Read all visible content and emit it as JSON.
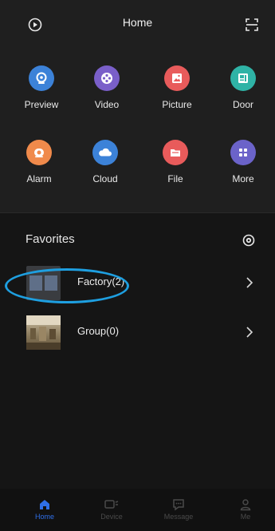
{
  "header": {
    "title": "Home",
    "left_icon": "playback-icon",
    "right_icon": "scan-icon"
  },
  "quick_actions": [
    {
      "label": "Preview",
      "icon": "camera-icon",
      "color": "#3c82d8"
    },
    {
      "label": "Video",
      "icon": "film-reel-icon",
      "color": "#7a5fc9"
    },
    {
      "label": "Picture",
      "icon": "picture-icon",
      "color": "#e85b5b"
    },
    {
      "label": "Door",
      "icon": "door-icon",
      "color": "#2fb3a6"
    },
    {
      "label": "Alarm",
      "icon": "alarm-icon",
      "color": "#f08a4b"
    },
    {
      "label": "Cloud",
      "icon": "cloud-icon",
      "color": "#3c82d8"
    },
    {
      "label": "File",
      "icon": "folder-icon",
      "color": "#e85b5b"
    },
    {
      "label": "More",
      "icon": "grid-icon",
      "color": "#6b63c9"
    }
  ],
  "favorites": {
    "title": "Favorites",
    "items": [
      {
        "name": "Factory(2)"
      },
      {
        "name": "Group(0)"
      }
    ]
  },
  "tabbar": {
    "items": [
      {
        "label": "Home",
        "icon": "home-icon",
        "active": true
      },
      {
        "label": "Device",
        "icon": "device-icon",
        "active": false
      },
      {
        "label": "Message",
        "icon": "message-icon",
        "active": false
      },
      {
        "label": "Me",
        "icon": "person-icon",
        "active": false
      }
    ]
  },
  "colors": {
    "accent": "#2f6fe8",
    "highlight_ring": "#1e9fe0",
    "background": "#151515",
    "panel": "#1f1f1f"
  }
}
